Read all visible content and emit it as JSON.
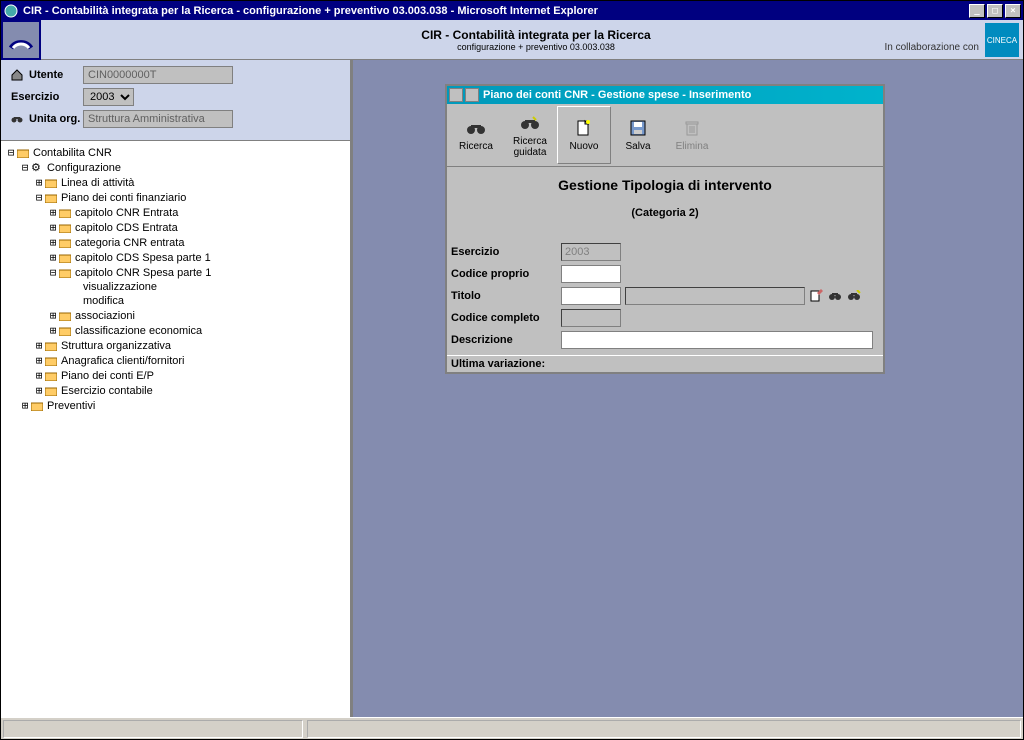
{
  "window": {
    "title": "CIR - Contabilità integrata per la Ricerca - configurazione + preventivo 03.003.038 - Microsoft Internet Explorer"
  },
  "header": {
    "title": "CIR - Contabilità integrata per la Ricerca",
    "subtitle": "configurazione + preventivo 03.003.038",
    "collab": "In collaborazione con",
    "logo_right": "CINECA"
  },
  "sidebar": {
    "fields": {
      "utente_label": "Utente",
      "utente_value": "CIN0000000T",
      "esercizio_label": "Esercizio",
      "esercizio_value": "2003",
      "unita_label": "Unita org.",
      "unita_value": "Struttura Amministrativa"
    },
    "tree": {
      "root": "Contabilita CNR",
      "configurazione": "Configurazione",
      "linea_attivita": "Linea di attività",
      "piano_conti_fin": "Piano dei conti finanziario",
      "cap_cnr_entrata": "capitolo CNR Entrata",
      "cap_cds_entrata": "capitolo CDS Entrata",
      "cat_cnr_entrata": "categoria CNR entrata",
      "cap_cds_spesa1": "capitolo CDS Spesa parte 1",
      "cap_cnr_spesa1": "capitolo CNR Spesa parte 1",
      "visualizzazione": "visualizzazione",
      "modifica": "modifica",
      "associazioni": "associazioni",
      "class_econ": "classificazione economica",
      "struttura_org": "Struttura organizzativa",
      "anagrafica": "Anagrafica clienti/fornitori",
      "piano_conti_ep": "Piano dei conti E/P",
      "esercizio_cont": "Esercizio contabile",
      "preventivi": "Preventivi"
    }
  },
  "inner": {
    "title": "Piano dei conti CNR - Gestione spese - Inserimento",
    "toolbar": {
      "ricerca": "Ricerca",
      "ricerca_guidata": "Ricerca guidata",
      "nuovo": "Nuovo",
      "salva": "Salva",
      "elimina": "Elimina"
    },
    "heading": "Gestione Tipologia di intervento",
    "subheading": "(Categoria 2)",
    "form": {
      "esercizio_label": "Esercizio",
      "esercizio_value": "2003",
      "codice_proprio_label": "Codice proprio",
      "codice_proprio_value": "",
      "titolo_label": "Titolo",
      "titolo_value": "",
      "titolo_desc_value": "",
      "codice_completo_label": "Codice completo",
      "codice_completo_value": "",
      "descrizione_label": "Descrizione",
      "descrizione_value": ""
    },
    "status": "Ultima variazione:"
  }
}
